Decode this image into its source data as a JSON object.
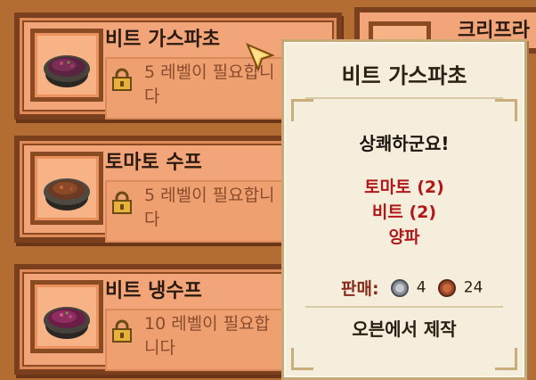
{
  "recipes": [
    {
      "title": "비트 가스파초",
      "requirement": "5 레벨이 필요합니다",
      "icon": "beet-gazpacho-bowl-icon"
    },
    {
      "title": "토마토 수프",
      "requirement": "5 레벨이 필요합니다",
      "icon": "tomato-soup-bowl-icon"
    },
    {
      "title": "비트 냉수프",
      "requirement": "10 레벨이 필요합니다",
      "icon": "cold-beet-soup-bowl-icon"
    }
  ],
  "partial_card": {
    "title": "크리프라"
  },
  "tooltip": {
    "title": "비트 가스파초",
    "description": "상쾌하군요!",
    "ingredients": [
      "토마토 (2)",
      "비트 (2)",
      "양파"
    ],
    "sell_label": "판매:",
    "silver_value": "4",
    "bronze_value": "24",
    "footer": "오븐에서 제작"
  },
  "colors": {
    "card": "#f3a57a",
    "ingredient": "#b0181a",
    "tooltip_bg": "#f6eedc"
  }
}
